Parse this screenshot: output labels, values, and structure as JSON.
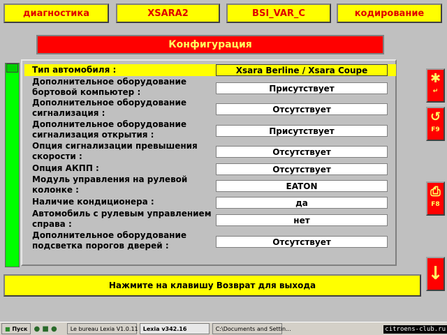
{
  "tabs": [
    "диагностика",
    "XSARA2",
    "BSI_VAR_C",
    "кодирование"
  ],
  "title": "Конфигурация",
  "rows": [
    {
      "label": "Тип автомобиля  :",
      "value": "Xsara Berline / Xsara Coupe",
      "selected": true
    },
    {
      "label": "Дополнительное оборудование бортовой компьютер  :",
      "value": "Присутствует"
    },
    {
      "label": "Дополнительное оборудование сигнализация  :",
      "value": "Отсутствует"
    },
    {
      "label": "Дополнительное оборудование сигнализация открытия  :",
      "value": "Присутствует"
    },
    {
      "label": "Опция сигнализации превышения скорости  :",
      "value": "Отсутствует"
    },
    {
      "label": "Опция АКПП  :",
      "value": "Отсутствует"
    },
    {
      "label": "Модуль управления на рулевой колонке  :",
      "value": "EATON"
    },
    {
      "label": "Наличие кондиционера  :",
      "value": "да"
    },
    {
      "label": "Автомобиль с рулевым управлением справа  :",
      "value": "нет"
    },
    {
      "label": "Дополнительное оборудование подсветка порогов дверей  :",
      "value": "Отсутствует"
    }
  ],
  "bottom_message": "Нажмите на клавишу Возврат для выхода",
  "side_buttons": [
    {
      "icon": "asterisk-enter-icon",
      "key": ""
    },
    {
      "icon": "refresh-icon",
      "key": "F9"
    },
    {
      "icon": "print-icon",
      "key": "F8"
    },
    {
      "icon": "arrow-down-icon",
      "key": ""
    }
  ],
  "taskbar": {
    "start": "Пуск",
    "items": [
      "Le bureau Lexia V1.0.11",
      "Lexia v342.16",
      "C:\\Documents and Settin..."
    ],
    "watermark": "citroens-club.ru"
  }
}
